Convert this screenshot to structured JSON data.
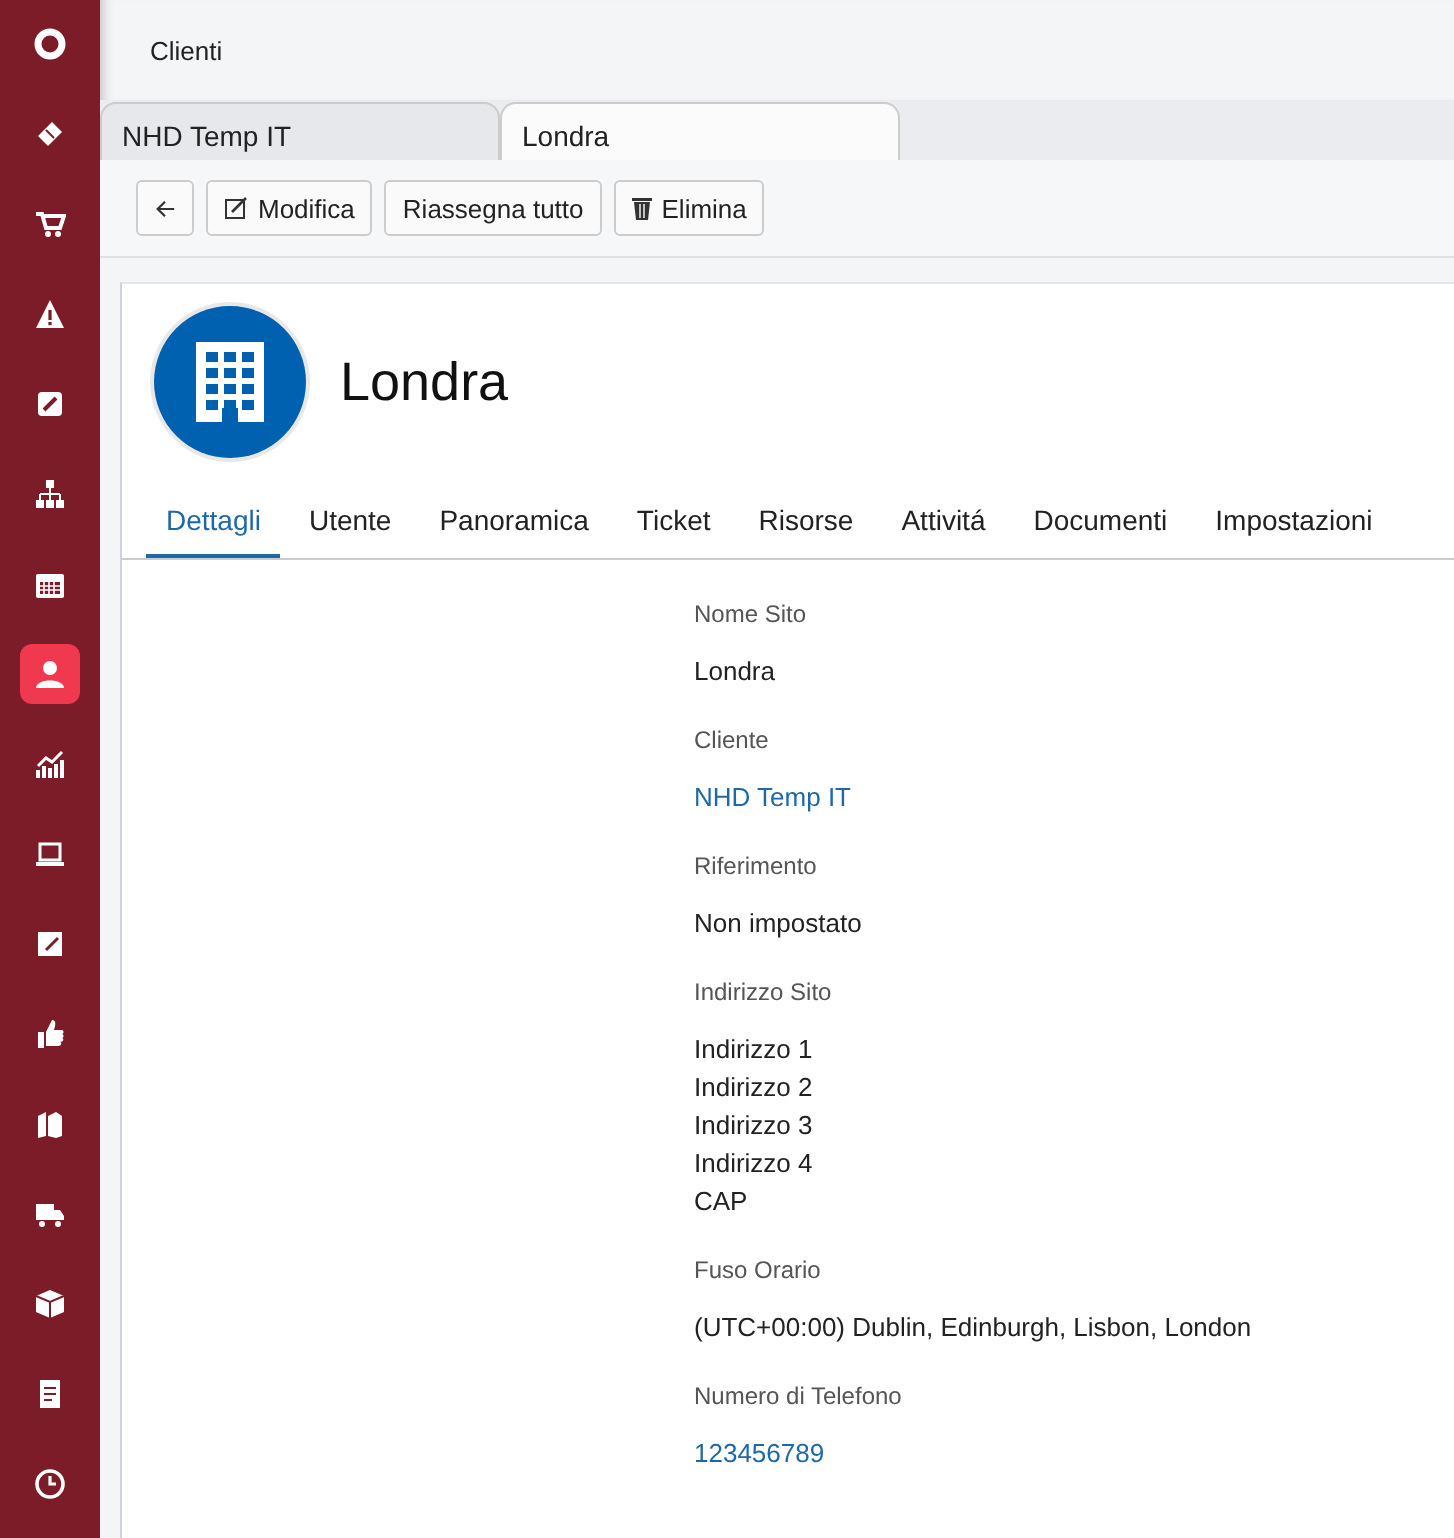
{
  "sidebar": {
    "items": [
      {
        "selected": false
      },
      {
        "selected": false
      },
      {
        "selected": false
      },
      {
        "selected": false
      },
      {
        "selected": false
      },
      {
        "selected": false
      },
      {
        "selected": false
      },
      {
        "selected": true
      },
      {
        "selected": false
      },
      {
        "selected": false
      },
      {
        "selected": false
      },
      {
        "selected": false
      },
      {
        "selected": false
      },
      {
        "selected": false
      },
      {
        "selected": false
      },
      {
        "selected": false
      },
      {
        "selected": false
      }
    ]
  },
  "breadcrumb": "Clienti",
  "doc_tabs": [
    {
      "label": "NHD Temp IT",
      "selected": false
    },
    {
      "label": "Londra",
      "selected": true
    }
  ],
  "toolbar": {
    "buttons": [
      {
        "kind": "back"
      },
      {
        "kind": "edit",
        "label": "Modifica"
      },
      {
        "kind": "plain",
        "label": "Riassegna tutto"
      },
      {
        "kind": "delete",
        "label": "Elimina"
      }
    ]
  },
  "record": {
    "title": "Londra",
    "tabs": [
      {
        "label": "Dettagli",
        "selected": true
      },
      {
        "label": "Utente",
        "selected": false
      },
      {
        "label": "Panoramica",
        "selected": false
      },
      {
        "label": "Ticket",
        "selected": false
      },
      {
        "label": "Risorse",
        "selected": false
      },
      {
        "label": "Attivitá",
        "selected": false
      },
      {
        "label": "Documenti",
        "selected": false
      },
      {
        "label": "Impostazioni",
        "selected": false
      }
    ],
    "fields": [
      {
        "label": "Nome Sito",
        "kind": "text",
        "values": [
          "Londra"
        ]
      },
      {
        "label": "Cliente",
        "kind": "link",
        "values": [
          "NHD Temp IT"
        ]
      },
      {
        "label": "Riferimento",
        "kind": "text",
        "values": [
          "Non impostato"
        ]
      },
      {
        "label": "Indirizzo Sito",
        "kind": "text",
        "values": [
          "Indirizzo 1",
          "Indirizzo 2",
          "Indirizzo 3",
          "Indirizzo 4",
          "CAP"
        ]
      },
      {
        "label": "Fuso Orario",
        "kind": "text",
        "values": [
          "(UTC+00:00) Dublin, Edinburgh, Lisbon, London"
        ]
      },
      {
        "label": "Numero di Telefono",
        "kind": "link",
        "values": [
          "123456789"
        ]
      }
    ]
  }
}
